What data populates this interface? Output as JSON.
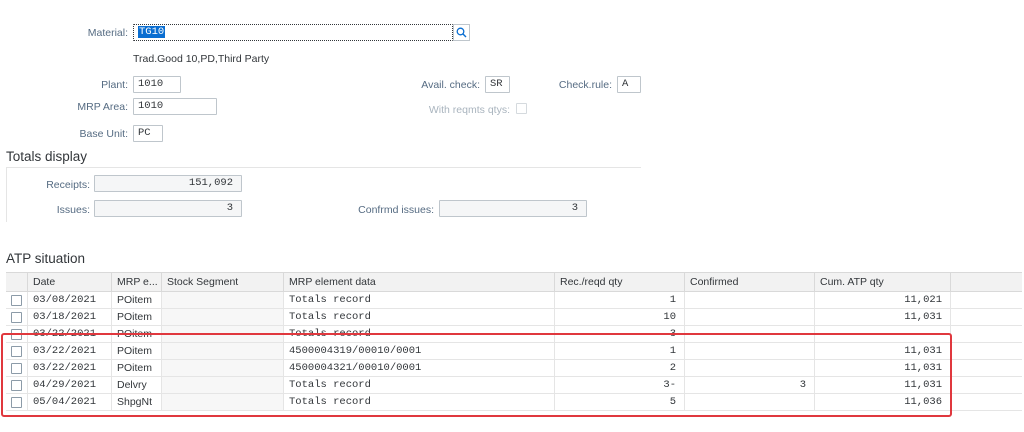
{
  "header": {
    "material_label": "Material:",
    "material_value": "TG10",
    "material_desc": "Trad.Good 10,PD,Third Party",
    "plant_label": "Plant:",
    "plant_value": "1010",
    "mrp_area_label": "MRP Area:",
    "mrp_area_value": "1010",
    "base_unit_label": "Base Unit:",
    "base_unit_value": "PC",
    "avail_check_label": "Avail. check:",
    "avail_check_value": "SR",
    "check_rule_label": "Check.rule:",
    "check_rule_value": "A",
    "with_reqmts_label": "With reqmts qtys:"
  },
  "totals": {
    "title": "Totals display",
    "receipts_label": "Receipts:",
    "receipts_value": "151,092",
    "issues_label": "Issues:",
    "issues_value": "3",
    "confirmed_issues_label": "Confrmd issues:",
    "confirmed_issues_value": "3"
  },
  "atp": {
    "title": "ATP situation",
    "columns": [
      "Date",
      "MRP e...",
      "Stock Segment",
      "MRP element data",
      "Rec./reqd qty",
      "Confirmed",
      "Cum. ATP qty"
    ],
    "rows": [
      {
        "date": "03/08/2021",
        "mrp": "POitem",
        "segment": "",
        "element": "Totals record",
        "qty": "1",
        "confirmed": "",
        "cum": "11,021"
      },
      {
        "date": "03/18/2021",
        "mrp": "POitem",
        "segment": "",
        "element": "Totals record",
        "qty": "10",
        "confirmed": "",
        "cum": "11,031"
      },
      {
        "date": "03/22/2021",
        "mrp": "POitem",
        "segment": "",
        "element": "Totals record",
        "qty": "3",
        "confirmed": "",
        "cum": ""
      },
      {
        "date": "03/22/2021",
        "mrp": "POitem",
        "segment": "",
        "element": "4500004319/00010/0001",
        "qty": "1",
        "confirmed": "",
        "cum": "11,031"
      },
      {
        "date": "03/22/2021",
        "mrp": "POitem",
        "segment": "",
        "element": "4500004321/00010/0001",
        "qty": "2",
        "confirmed": "",
        "cum": "11,031"
      },
      {
        "date": "04/29/2021",
        "mrp": "Delvry",
        "segment": "",
        "element": "Totals record",
        "qty": "3-",
        "confirmed": "3",
        "cum": "11,031"
      },
      {
        "date": "05/04/2021",
        "mrp": "ShpgNt",
        "segment": "",
        "element": "Totals record",
        "qty": "5",
        "confirmed": "",
        "cum": "11,036"
      }
    ]
  },
  "icons": {
    "search": "magnifier-icon",
    "checkbox": "checkbox-icon"
  },
  "colors": {
    "highlight": "#e0383e",
    "selection": "#0a6ed1",
    "label": "#556b82"
  }
}
